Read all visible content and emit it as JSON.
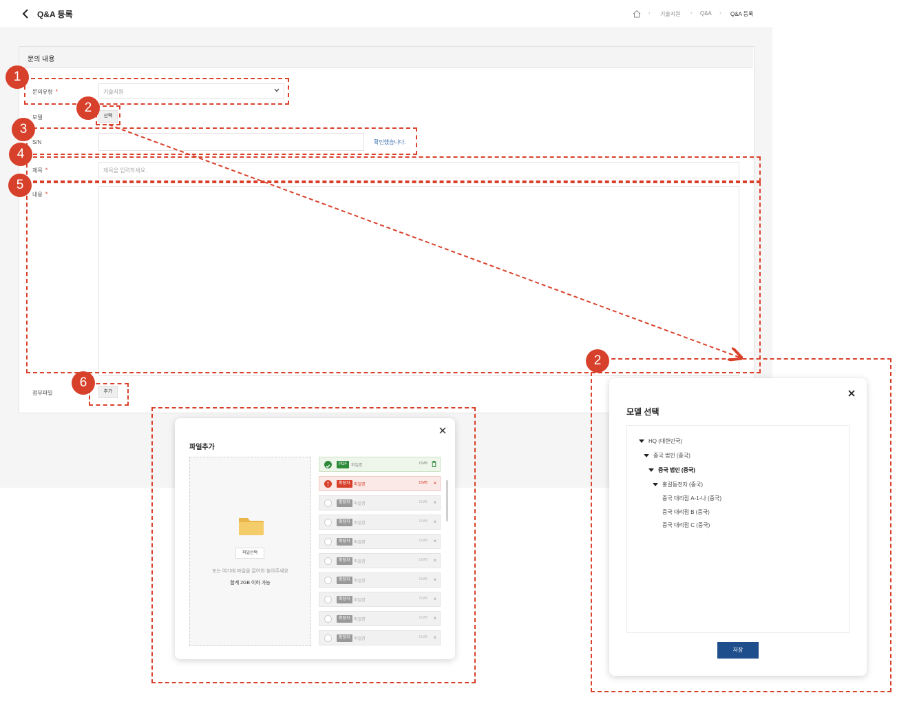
{
  "header": {
    "title": "Q&A 등록",
    "breadcrumb": [
      "기술지원",
      "Q&A",
      "Q&A 등록"
    ]
  },
  "form": {
    "section_title": "문의 내용",
    "required_mark": "*",
    "type_label": "문의유형",
    "type_value": "기술지원",
    "model_label": "모델",
    "model_button": "선택",
    "sn_label": "S/N",
    "sn_confirm": "확인했습니다.",
    "title_label": "제목",
    "title_placeholder": "제목을 입력하세요.",
    "content_label": "내용",
    "attach_label": "첨부파일",
    "attach_button": "추가"
  },
  "markers": [
    "1",
    "2",
    "3",
    "4",
    "5",
    "6",
    "2"
  ],
  "file_modal": {
    "title": "파일추가",
    "select_button": "파일선택",
    "drop_hint": "또는 여기에 파일을 끌어와 놓아주세요",
    "limit": "합계 2GB 이하 가능",
    "files": [
      {
        "ext": "PDF",
        "name": "파일명",
        "size": "15MB",
        "status": "ok"
      },
      {
        "ext": "확장자",
        "name": "파일명",
        "size": "15MB",
        "status": "error"
      },
      {
        "ext": "확장자",
        "name": "파일명",
        "size": "15MB",
        "status": "idle"
      },
      {
        "ext": "확장자",
        "name": "파일명",
        "size": "15MB",
        "status": "idle"
      },
      {
        "ext": "확장자",
        "name": "파일명",
        "size": "15MB",
        "status": "idle"
      },
      {
        "ext": "확장자",
        "name": "파일명",
        "size": "15MB",
        "status": "idle"
      },
      {
        "ext": "확장자",
        "name": "파일명",
        "size": "15MB",
        "status": "idle"
      },
      {
        "ext": "확장자",
        "name": "파일명",
        "size": "15MB",
        "status": "idle"
      },
      {
        "ext": "확장자",
        "name": "파일명",
        "size": "15MB",
        "status": "idle"
      },
      {
        "ext": "확장자",
        "name": "파일명",
        "size": "15MB",
        "status": "idle"
      }
    ]
  },
  "model_modal": {
    "title": "모델 선택",
    "tree": [
      {
        "label": "HQ (대한민국)",
        "expanded": true
      },
      {
        "label": "중국 법인 (중국)",
        "expanded": true
      },
      {
        "label": "중국 법인 (중국)",
        "expanded": true,
        "selected": true
      },
      {
        "label": "홍길동전자 (중국)",
        "expanded": true
      },
      {
        "label": "중국 대리점 A-1-나 (중국)"
      },
      {
        "label": "중국 대리점 B (중국)"
      },
      {
        "label": "중국 대리점 C (중국)"
      }
    ],
    "save_button": "저장"
  },
  "colors": {
    "annotation": "#d9402a",
    "primary": "#1f4e8c",
    "success": "#2e8b3a",
    "error": "#d7402a",
    "link": "#3a6fb0"
  }
}
